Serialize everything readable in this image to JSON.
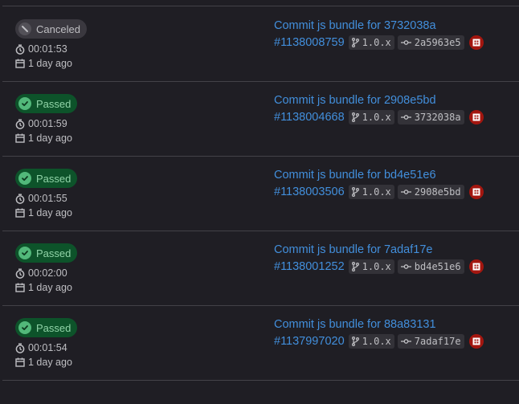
{
  "pipelines": [
    {
      "status": "Canceled",
      "status_kind": "canceled",
      "duration": "00:01:53",
      "finished": "1 day ago",
      "title": "Commit js bundle for 3732038a",
      "pipeline_id": "#1138008759",
      "branch": "1.0.x",
      "commit": "2a5963e5"
    },
    {
      "status": "Passed",
      "status_kind": "passed",
      "duration": "00:01:59",
      "finished": "1 day ago",
      "title": "Commit js bundle for 2908e5bd",
      "pipeline_id": "#1138004668",
      "branch": "1.0.x",
      "commit": "3732038a"
    },
    {
      "status": "Passed",
      "status_kind": "passed",
      "duration": "00:01:55",
      "finished": "1 day ago",
      "title": "Commit js bundle for bd4e51e6",
      "pipeline_id": "#1138003506",
      "branch": "1.0.x",
      "commit": "2908e5bd"
    },
    {
      "status": "Passed",
      "status_kind": "passed",
      "duration": "00:02:00",
      "finished": "1 day ago",
      "title": "Commit js bundle for 7adaf17e",
      "pipeline_id": "#1138001252",
      "branch": "1.0.x",
      "commit": "bd4e51e6"
    },
    {
      "status": "Passed",
      "status_kind": "passed",
      "duration": "00:01:54",
      "finished": "1 day ago",
      "title": "Commit js bundle for 88a83131",
      "pipeline_id": "#1137997020",
      "branch": "1.0.x",
      "commit": "7adaf17e"
    }
  ],
  "icons": {
    "duration": "timer-icon",
    "finished": "calendar-icon",
    "branch": "branch-icon",
    "commit": "commit-icon",
    "avatar": "user-avatar-icon"
  },
  "colors": {
    "background": "#1f1e24",
    "link": "#428fdc",
    "passed_bg": "#0d532a",
    "passed_fg": "#91d4a8",
    "canceled_bg": "#3a383f",
    "avatar": "#a3160f"
  }
}
